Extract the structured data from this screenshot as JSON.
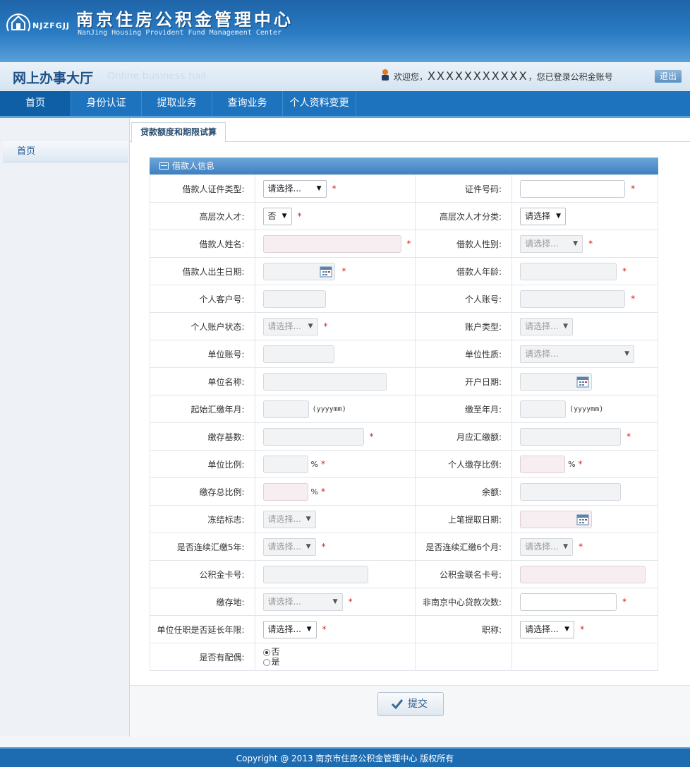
{
  "header": {
    "logo_text": "NJZFGJJ",
    "title": "南京住房公积金管理中心",
    "subtitle": "NanJing Housing Provident Fund Management Center"
  },
  "hall": {
    "title": "网上办事大厅",
    "subtitle": "Online business hall",
    "welcome_prefix": "欢迎您，",
    "masked_account": "XXXXXXXXXXX",
    "welcome_suffix": "，您已登录公积金账号",
    "logout": "退出"
  },
  "nav": [
    "首页",
    "身份认证",
    "提取业务",
    "查询业务",
    "个人资料变更"
  ],
  "sidebar": {
    "item": "首页"
  },
  "tab": "贷款额度和期限试算",
  "panel_title": "借款人信息",
  "rows": [
    {
      "l1": "借款人证件类型:",
      "v1": "请选择...",
      "l2": "证件号码:"
    },
    {
      "l1": "高层次人才:",
      "v1": "否",
      "l2": "高层次人才分类:",
      "v2": "请选择"
    },
    {
      "l1": "借款人姓名:",
      "l2": "借款人性别:",
      "v2": "请选择..."
    },
    {
      "l1": "借款人出生日期:",
      "l2": "借款人年龄:"
    },
    {
      "l1": "个人客户号:",
      "l2": "个人账号:"
    },
    {
      "l1": "个人账户状态:",
      "v1": "请选择...",
      "l2": "账户类型:",
      "v2": "请选择..."
    },
    {
      "l1": "单位账号:",
      "l2": "单位性质:",
      "v2": "请选择..."
    },
    {
      "l1": "单位名称:",
      "l2": "开户日期:"
    },
    {
      "l1": "起始汇缴年月:",
      "h1": "(yyyymm)",
      "l2": "缴至年月:",
      "h2": "(yyyymm)"
    },
    {
      "l1": "缴存基数:",
      "l2": "月应汇缴额:"
    },
    {
      "l1": "单位比例:",
      "p1": "%",
      "l2": "个人缴存比例:",
      "p2": "%"
    },
    {
      "l1": "缴存总比例:",
      "p1": "%",
      "l2": "余额:"
    },
    {
      "l1": "冻结标志:",
      "v1": "请选择...",
      "l2": "上笔提取日期:"
    },
    {
      "l1": "是否连续汇缴5年:",
      "v1": "请选择...",
      "l2": "是否连续汇缴6个月:",
      "v2": "请选择..."
    },
    {
      "l1": "公积金卡号:",
      "l2": "公积金联名卡号:"
    },
    {
      "l1": "缴存地:",
      "v1": "请选择...",
      "l2": "非南京中心贷款次数:"
    },
    {
      "l1": "单位任职是否延长年限:",
      "v1": "请选择...",
      "l2": "职称:",
      "v2": "请选择..."
    },
    {
      "l1": "是否有配偶:",
      "r_no": "否",
      "r_yes": "是"
    }
  ],
  "required_mark": "*",
  "submit": "提交",
  "footer": "Copyright @ 2013 南京市住房公积金管理中心 版权所有",
  "colors": {
    "nav_bg": "#1d73bd",
    "header_bg": "#2a7cc4",
    "required": "#d41f1f"
  }
}
